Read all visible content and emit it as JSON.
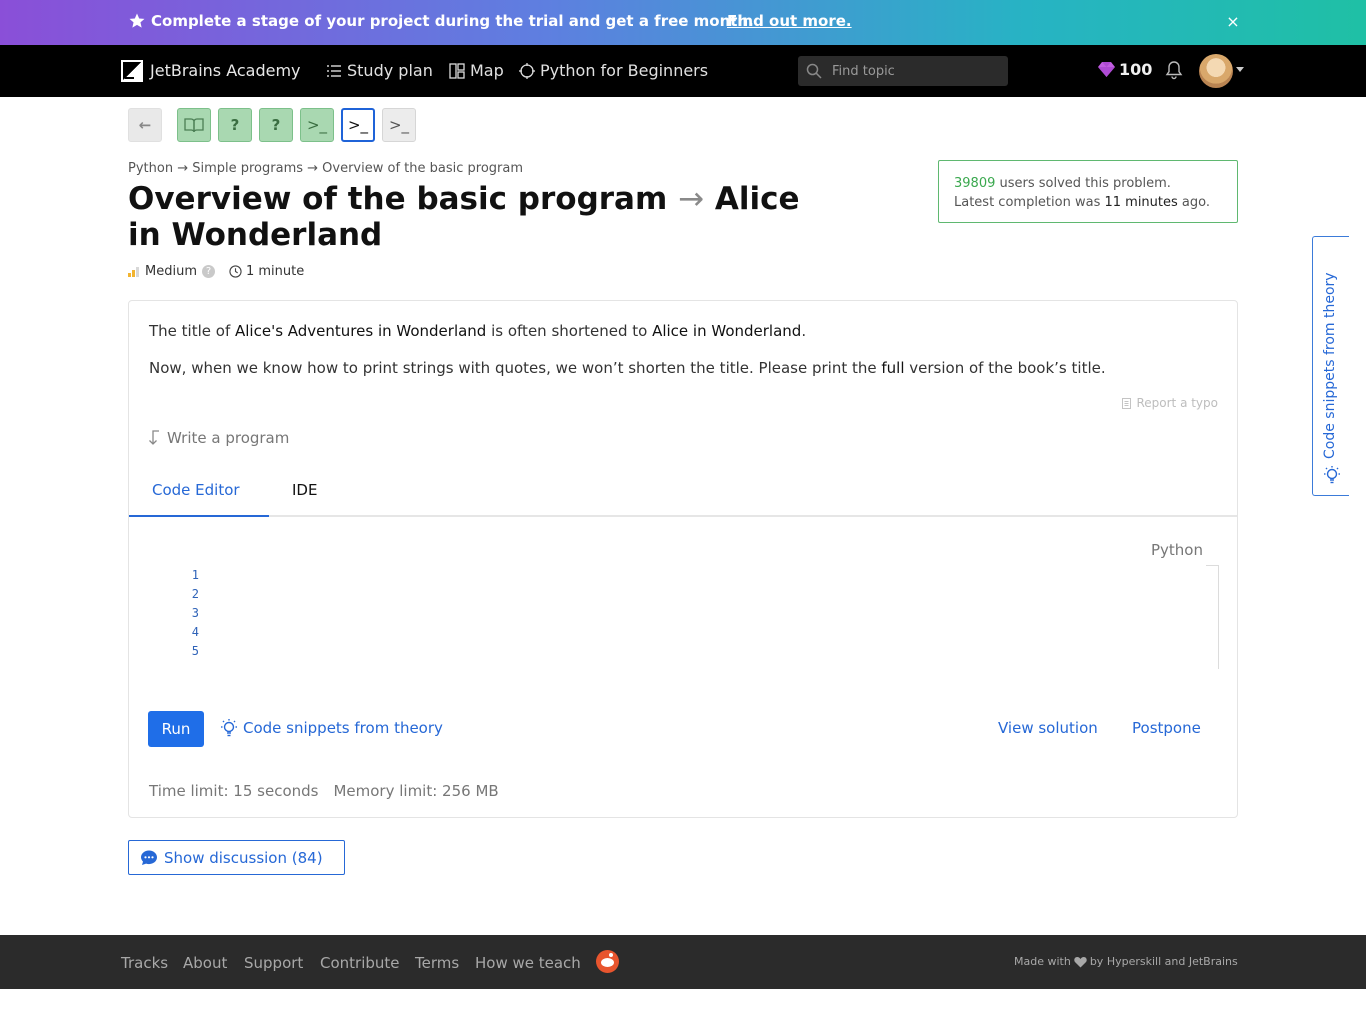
{
  "promo": {
    "message": "Complete a stage of your project during the trial and get a free month.",
    "link": "Find out more.",
    "close": "×"
  },
  "nav": {
    "logo": "JetBrains Academy",
    "study_plan": "Study plan",
    "map": "Map",
    "track": "Python for Beginners",
    "search_placeholder": "Find topic",
    "gems": "100"
  },
  "steps": [
    {
      "state": "back",
      "glyph": "←"
    },
    {
      "state": "done",
      "glyph": "book"
    },
    {
      "state": "done",
      "glyph": "?"
    },
    {
      "state": "done",
      "glyph": "?"
    },
    {
      "state": "done",
      "glyph": ">_"
    },
    {
      "state": "current",
      "glyph": ">_"
    },
    {
      "state": "todo",
      "glyph": ">_"
    }
  ],
  "header": {
    "breadcrumb": "Python → Simple programs → Overview of the basic program",
    "title_topic": "Overview of the basic program",
    "title_arrow": "→",
    "title_task": "Alice in Wonderland",
    "difficulty": "Medium",
    "difficulty_help": "?",
    "duration": "1 minute"
  },
  "solved": {
    "count": "39809",
    "text1": " users solved this problem.",
    "text2": "Latest completion was ",
    "time": "11 minutes",
    "text3": " ago."
  },
  "side_tab": {
    "label": "Code snippets from theory"
  },
  "task": {
    "p1_a": "The title of ",
    "p1_b": "Alice's Adventures in Wonderland",
    "p1_c": " is often shortened to ",
    "p1_d": "Alice in Wonderland",
    "p1_e": ".",
    "p2_a": "Now, when we know how to print strings with quotes, we won’t shorten the title. Please print the ",
    "p2_b": "full",
    "p2_c": " version of the book’s title.",
    "report_typo": "Report a typo",
    "write_program": "Write a program"
  },
  "editor": {
    "tabs": [
      "Code Editor",
      "IDE"
    ],
    "language": "Python",
    "line_numbers": [
      "1",
      "2",
      "3",
      "4",
      "5"
    ],
    "run": "Run",
    "snippets": "Code snippets from theory",
    "view_solution": "View solution",
    "postpone": "Postpone",
    "time_limit": "Time limit: 15 seconds",
    "memory_limit": "Memory limit: 256 MB"
  },
  "discussion": {
    "label": "Show discussion (84)"
  },
  "footer": {
    "links": [
      "Tracks",
      "About",
      "Support",
      "Contribute",
      "Terms",
      "How we teach"
    ],
    "made_with_a": "Made with",
    "made_with_b": "by Hyperskill and JetBrains"
  },
  "colors": {
    "accent": "#1f6ee8",
    "solved_green": "#3aa84e",
    "step_done": "#a9d8b1",
    "footer_bg": "#2b2b2b"
  }
}
